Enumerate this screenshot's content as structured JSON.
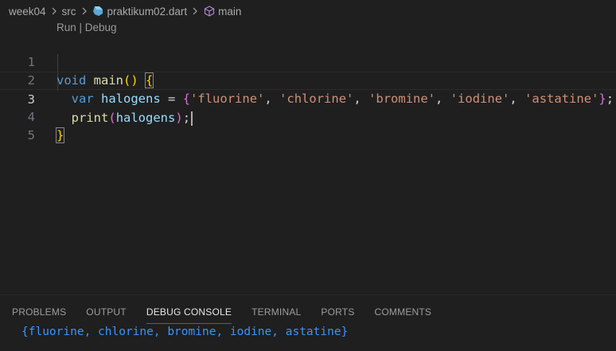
{
  "breadcrumb": {
    "items": [
      "week04",
      "src",
      "praktikum02.dart",
      "main"
    ]
  },
  "editor": {
    "codelens": "Run | Debug",
    "line_numbers": [
      "1",
      "2",
      "3",
      "4",
      "5"
    ],
    "code": {
      "l1_kw": "void",
      "l1_fn": "main",
      "l1_parens": "()",
      "l1_brace": "{",
      "l2_kw": "var",
      "l2_var": "halogens",
      "l2_eq": "=",
      "l2_open": "{",
      "strings": [
        "'fluorine'",
        "'chlorine'",
        "'bromine'",
        "'iodine'",
        "'astatine'"
      ],
      "l2_close": "}",
      "l3_fn": "print",
      "l3_arg": "halogens",
      "l4_brace": "}"
    }
  },
  "panel": {
    "tabs": [
      "PROBLEMS",
      "OUTPUT",
      "DEBUG CONSOLE",
      "TERMINAL",
      "PORTS",
      "COMMENTS"
    ],
    "active_tab": "DEBUG CONSOLE",
    "console_output": "{fluorine, chlorine, bromine, iodine, astatine}"
  },
  "colors": {
    "background": "#1f1f1f",
    "keyword": "#569cd6",
    "function": "#dcdcaa",
    "variable": "#9cdcfe",
    "string": "#ce9178",
    "bracket_level1": "#ffd700",
    "bracket_level2": "#da70d6",
    "console_text": "#3794ff",
    "active_tab_underline": "#0078d4"
  },
  "icons": {
    "separator": "chevron-right-icon",
    "file": "dart-file-icon",
    "symbol": "method-cube-icon"
  }
}
